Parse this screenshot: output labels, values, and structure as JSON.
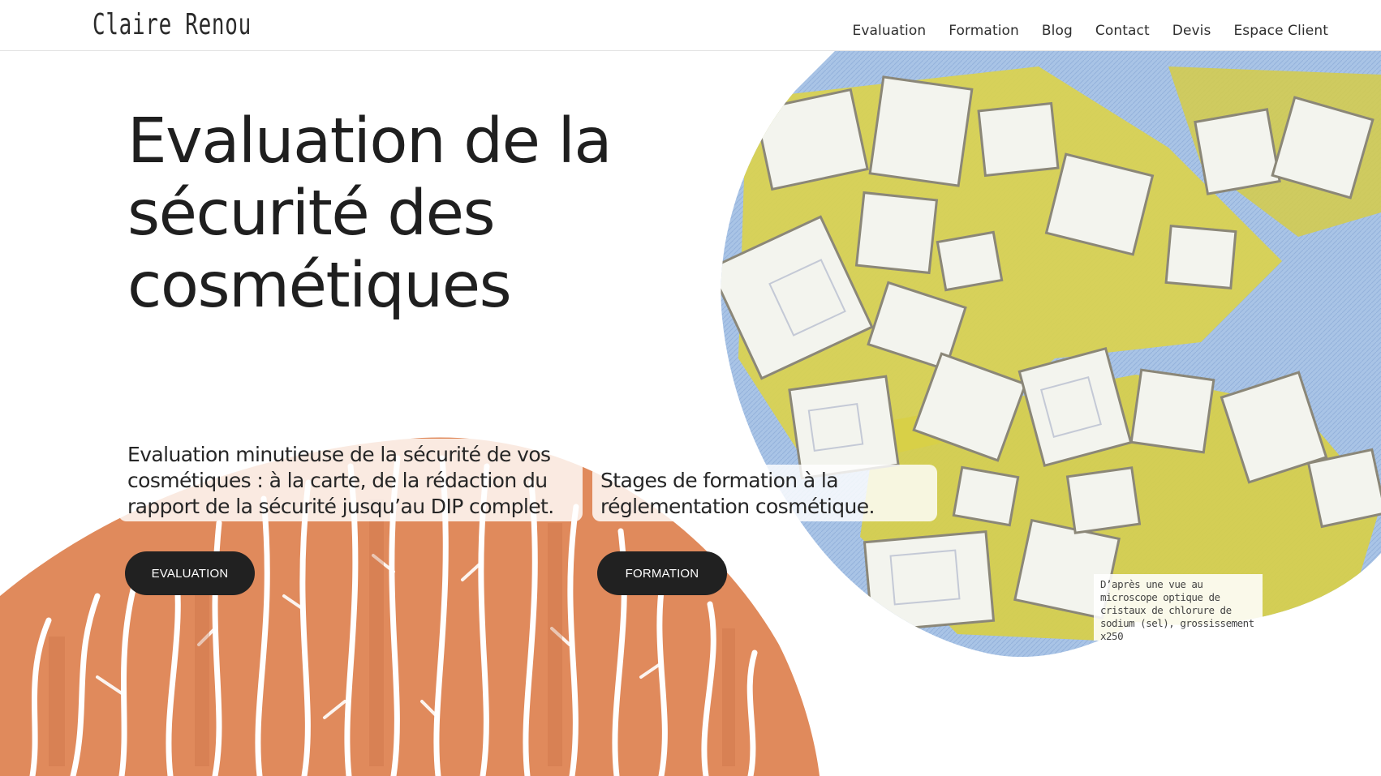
{
  "header": {
    "logo": "Claire Renou",
    "nav": [
      "Evaluation",
      "Formation",
      "Blog",
      "Contact",
      "Devis",
      "Espace Client"
    ]
  },
  "hero": {
    "title": "Evaluation de la sécurité des cosmétiques"
  },
  "evaluation": {
    "text": "Evaluation minutieuse de la sécurité de vos cosmétiques : à la carte, de la rédaction du rapport de la sécurité jusqu’au DIP complet.",
    "button": "EVALUATION"
  },
  "formation": {
    "text": "Stages de formation à la réglementation cosmétique.",
    "button": "FORMATION"
  },
  "illustration": {
    "caption": "D’après une vue au microscope optique de cristaux de chlorure de sodium (sel), grossissement x250",
    "colors": {
      "crystal_blue": "#a9c4e6",
      "crystal_yellow": "#dcd34a",
      "crystal_white": "#f4f5ee",
      "wood_orange": "#e08a5c",
      "button_dark": "#212121"
    }
  }
}
